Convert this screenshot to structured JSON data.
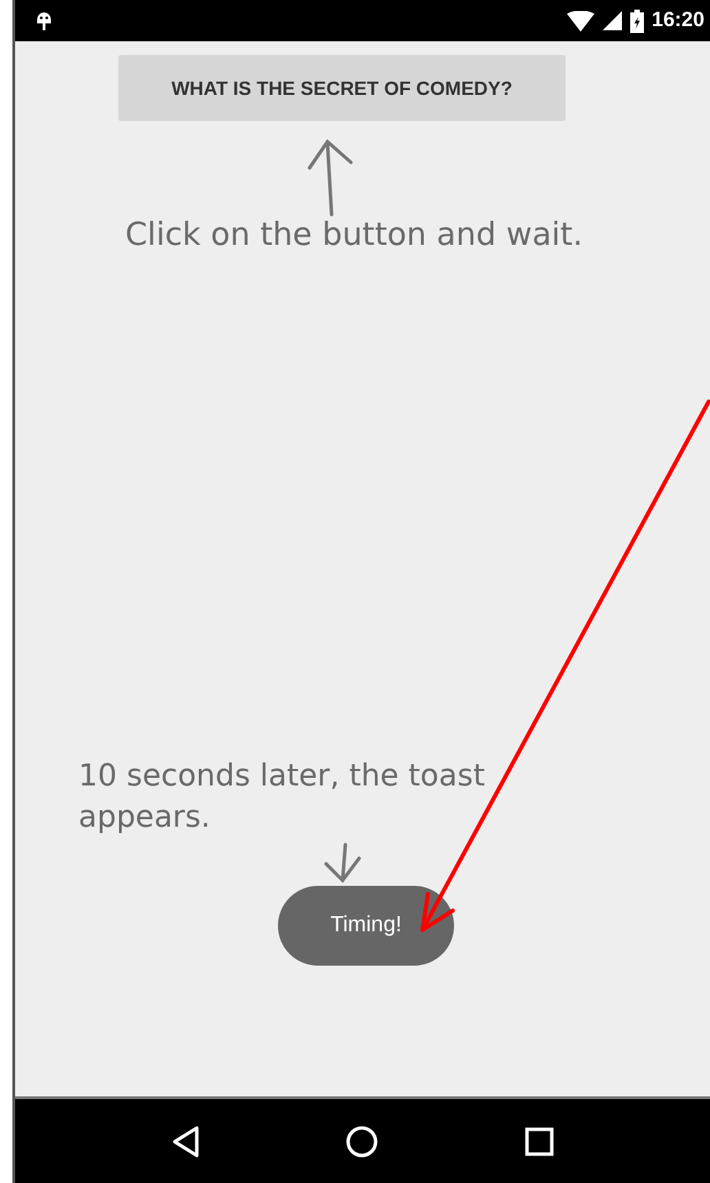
{
  "status_bar": {
    "time": "16:20"
  },
  "button": {
    "label": "WHAT IS THE SECRET OF COMEDY?"
  },
  "annotations": [
    {
      "text": "Click on the button and wait."
    },
    {
      "text": "10 seconds later, the toast appears."
    }
  ],
  "toast": {
    "text": "Timing!"
  }
}
